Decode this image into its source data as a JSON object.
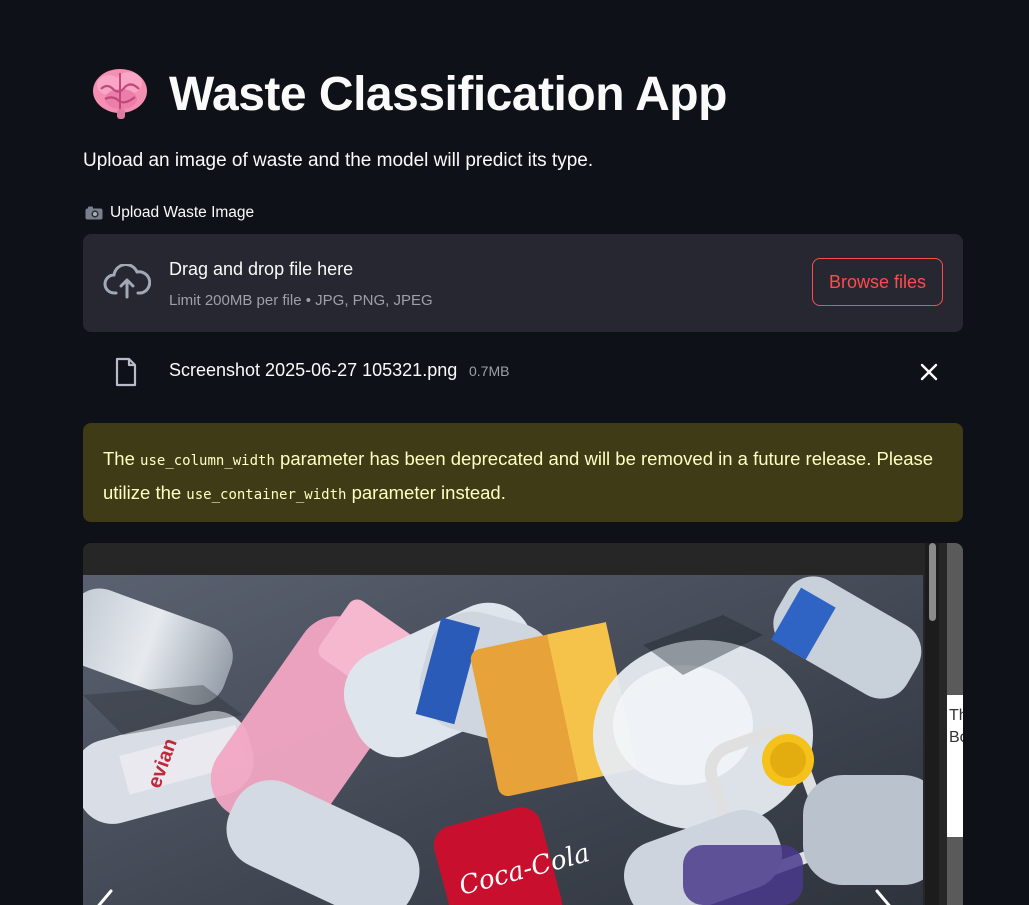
{
  "header": {
    "title": "Waste Classification App",
    "title_icon": "brain-emoji"
  },
  "intro": {
    "subtitle": "Upload an image of waste and the model will predict its type."
  },
  "uploader": {
    "label": "Upload Waste Image",
    "label_icon": "camera-icon",
    "drop_title": "Drag and drop file here",
    "limit_text": "Limit 200MB per file • JPG, PNG, JPEG",
    "browse_label": "Browse files",
    "accent_color": "#ff4b4b"
  },
  "uploaded_file": {
    "name": "Screenshot 2025-06-27 105321.png",
    "size": "0.7MB"
  },
  "warning": {
    "text_1": "The ",
    "code_1": "use_column_width",
    "text_2": " parameter has been deprecated and will be removed in a future release. Please utilize the ",
    "code_2": "use_container_width",
    "text_3": " parameter instead.",
    "background": "#3e3b16",
    "text_color": "#ffffc2"
  },
  "image_viewer": {
    "image_alt": "pile of plastic bottles",
    "side_text": "Th\nBo"
  }
}
